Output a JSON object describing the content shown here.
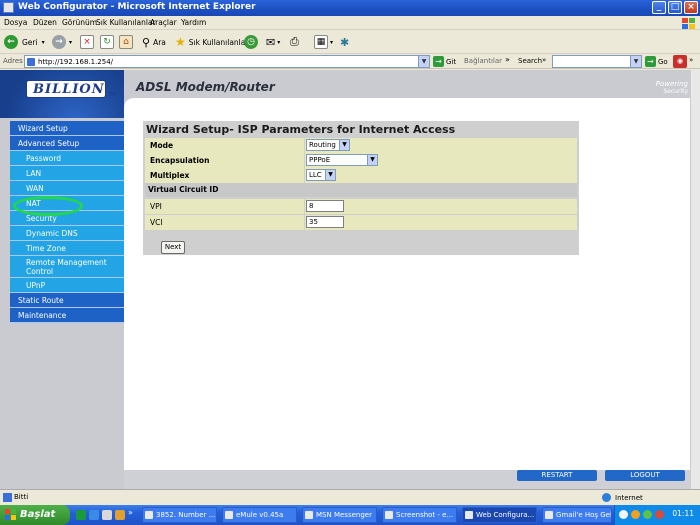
{
  "window": {
    "title": "Web Configurator - Microsoft Internet Explorer"
  },
  "menubar": [
    "Dosya",
    "Düzen",
    "Görünüm",
    "Sık Kullanılanlar",
    "Araçlar",
    "Yardım"
  ],
  "toolbar": {
    "back_label": "Geri",
    "search_label": "Ara",
    "favorites_label": "Sık Kullanılanlar"
  },
  "address": {
    "label": "Adres",
    "url": "http://192.168.1.254/",
    "go_label": "Git",
    "links_label": "Bağlantılar",
    "search_label": "Search",
    "go2_label": "Go"
  },
  "header": {
    "logo": "BILLION",
    "logo_tm": "TM",
    "title": "ADSL Modem/Router",
    "powering_line1": "Powering",
    "powering_line2": "Security"
  },
  "sidebar": {
    "items": [
      {
        "label": "Wizard Setup",
        "type": "main"
      },
      {
        "label": "Advanced Setup",
        "type": "main"
      },
      {
        "label": "Password",
        "type": "sub"
      },
      {
        "label": "LAN",
        "type": "sub"
      },
      {
        "label": "WAN",
        "type": "sub"
      },
      {
        "label": "NAT",
        "type": "sub"
      },
      {
        "label": "Security",
        "type": "sub"
      },
      {
        "label": "Dynamic DNS",
        "type": "sub"
      },
      {
        "label": "Time Zone",
        "type": "sub"
      },
      {
        "label": "Remote Management Control",
        "type": "sub"
      },
      {
        "label": "UPnP",
        "type": "sub"
      },
      {
        "label": "Static Route",
        "type": "main"
      },
      {
        "label": "Maintenance",
        "type": "main"
      }
    ]
  },
  "wizard": {
    "title": "Wizard Setup- ISP Parameters for Internet Access",
    "mode_label": "Mode",
    "mode_value": "Routing",
    "encapsulation_label": "Encapsulation",
    "encapsulation_value": "PPPoE",
    "multiplex_label": "Multiplex",
    "multiplex_value": "LLC",
    "vc_section": "Virtual Circuit ID",
    "vpi_label": "VPI",
    "vpi_value": "8",
    "vci_label": "VCI",
    "vci_value": "35",
    "next_label": "Next"
  },
  "footer_buttons": {
    "restart": "RESTART",
    "logout": "LOGOUT"
  },
  "status": {
    "text": "Bitti",
    "zone": "Internet"
  },
  "taskbar": {
    "start": "Başlat",
    "tasks": [
      {
        "label": "3852. Number ..."
      },
      {
        "label": "eMule v0.45a"
      },
      {
        "label": "MSN Messenger"
      },
      {
        "label": "Screenshot - e..."
      },
      {
        "label": "Web Configura...",
        "active": true
      },
      {
        "label": "Gmail'e Hoş Gel..."
      }
    ],
    "clock": "01:11"
  }
}
